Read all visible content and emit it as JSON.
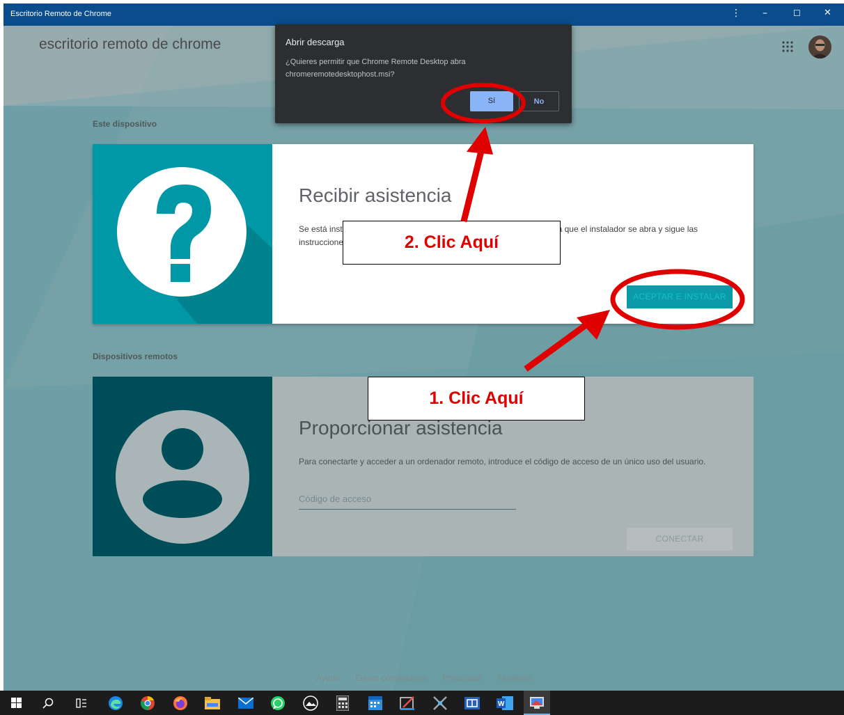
{
  "window": {
    "title": "Escritorio Remoto de Chrome",
    "controls": {
      "menu": "⋮",
      "minimize": "–",
      "maximize": "☐",
      "close": "✕"
    }
  },
  "app": {
    "brand": "escritorio remoto de chrome"
  },
  "sections": {
    "this_device": "Este dispositivo",
    "remote_devices": "Dispositivos remotos"
  },
  "receive_card": {
    "heading": "Recibir asistencia",
    "body": "Se está instalando el componente necesario en tu ordenador. Espera a que el instalador se abra y sigue las instrucciones.",
    "button": "ACEPTAR E INSTALAR"
  },
  "provide_card": {
    "heading": "Proporcionar asistencia",
    "body": "Para conectarte y acceder a un ordenador remoto, introduce el código de acceso de un único uso del usuario.",
    "input_placeholder": "Código de acceso",
    "button": "CONECTAR"
  },
  "footer": {
    "links": [
      "Ayuda",
      "Enviar comentarios",
      "Privacidad",
      "Términos"
    ]
  },
  "download_dialog": {
    "title": "Abrir descarga",
    "message": "¿Quieres permitir que Chrome Remote Desktop abra chromeremotedesktophost.msi?",
    "yes": "Sí",
    "no": "No"
  },
  "annotations": {
    "step1": "1.   Clic Aquí",
    "step2": "2.   Clic Aquí",
    "color": "#e00000"
  },
  "colors": {
    "teal": "#0097a7",
    "teal_dark": "#004d5a",
    "titlebar": "#0b4d8c",
    "dialog_bg": "#2d2e31",
    "dialog_accent": "#8ab4f8"
  },
  "taskbar": {
    "icons": [
      "windows-start-icon",
      "search-icon",
      "task-view-icon",
      "edge-icon",
      "chrome-icon",
      "firefox-icon",
      "file-explorer-icon",
      "mail-icon",
      "whatsapp-icon",
      "photos-icon",
      "calculator-icon",
      "calendar-icon",
      "paint-icon",
      "tools-icon",
      "remote-app-icon",
      "word-icon",
      "remote-desktop-icon"
    ]
  }
}
